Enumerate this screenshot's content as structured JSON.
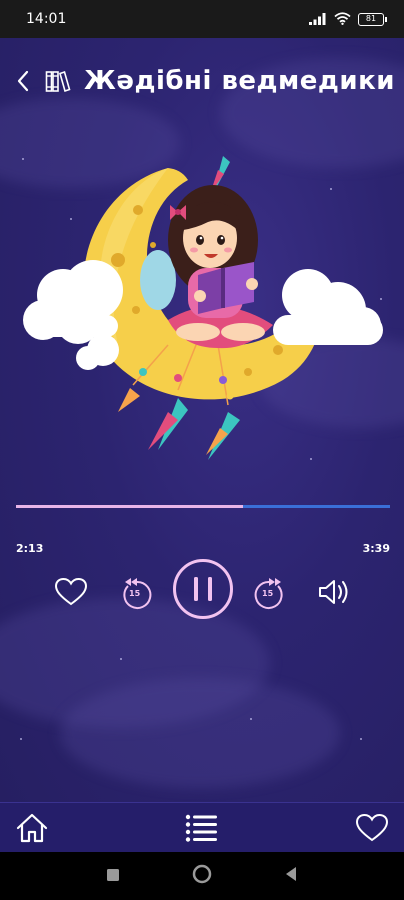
{
  "status_bar": {
    "time": "14:01",
    "battery": "81"
  },
  "header": {
    "title": "Жәдібні ведмедики"
  },
  "player": {
    "elapsed": "2:13",
    "total": "3:39",
    "progress_fraction": 0.607,
    "skip_back_seconds": "15",
    "skip_forward_seconds": "15"
  },
  "icons": {
    "back": "back-arrow-icon",
    "library": "books-icon",
    "favorite": "heart-icon",
    "rewind": "rewind-15-icon",
    "pause": "pause-icon",
    "forward": "forward-15-icon",
    "volume": "volume-icon",
    "home": "home-icon",
    "playlist": "playlist-icon",
    "favorites_nav": "heart-icon"
  },
  "colors": {
    "background": "#2a2168",
    "accent": "#f2c3f0",
    "progress_played": "#e8b5e8",
    "progress_remaining": "#3a6fd8",
    "nav_bar": "#251e6a"
  }
}
